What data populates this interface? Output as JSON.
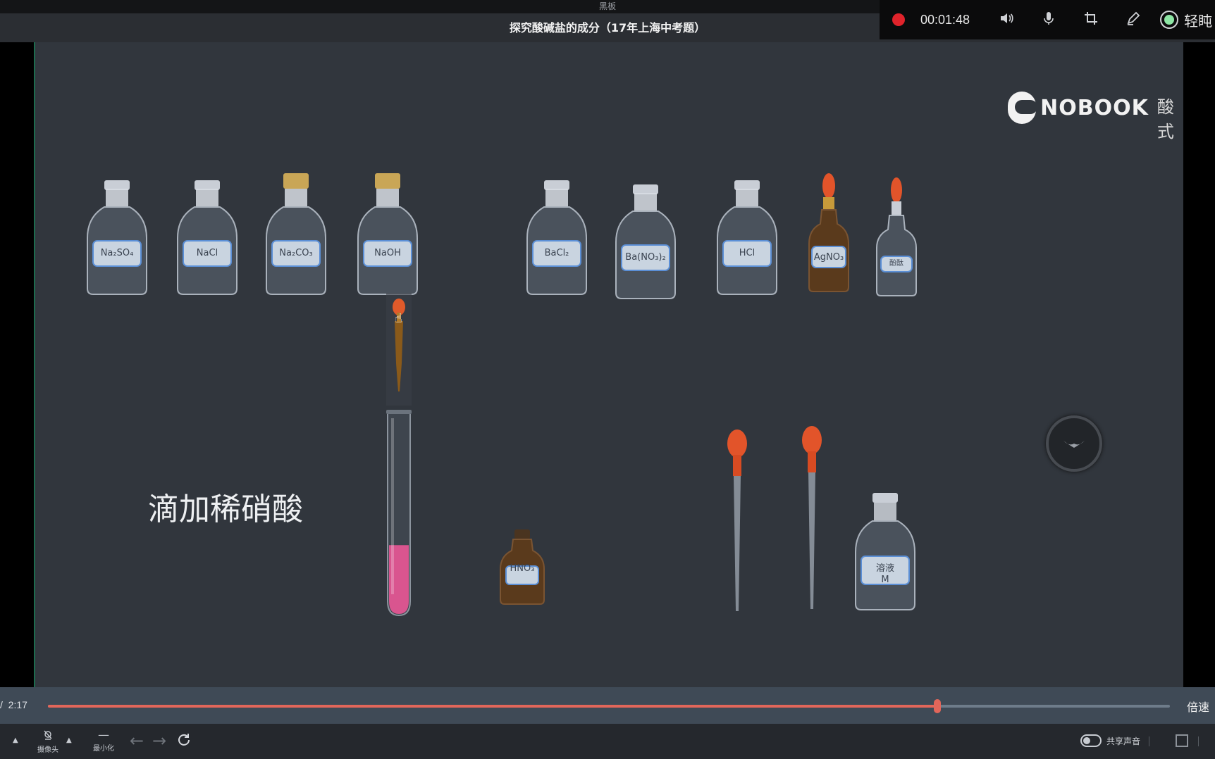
{
  "window": {
    "top_title": "黑板",
    "doc_title": "探究酸碱盐的成分（17年上海中考题）"
  },
  "recorder": {
    "time": "00:01:48",
    "icons": [
      "speaker-icon",
      "microphone-icon",
      "crop-icon",
      "pen-icon"
    ],
    "extra_text": "轻盹"
  },
  "stage": {
    "logo_text": "NOBOOK",
    "logo_sub": "酸式",
    "caption": "滴加稀硝酸",
    "top_bottles": [
      {
        "label": "Na₂SO₄",
        "type": "clear"
      },
      {
        "label": "NaCl",
        "type": "clear"
      },
      {
        "label": "Na₂CO₃",
        "type": "cork"
      },
      {
        "label": "NaOH",
        "type": "cork"
      },
      {
        "label": "BaCl₂",
        "type": "clear"
      },
      {
        "label": "Ba(NO₃)₂",
        "type": "clear"
      },
      {
        "label": "HCl",
        "type": "clear"
      },
      {
        "label": "AgNO₃",
        "type": "dropper-brown"
      },
      {
        "label": "酚酞",
        "type": "dropper-clear"
      }
    ],
    "small_bottle": {
      "label": "HNO₃"
    },
    "solution_bottle": {
      "label_line1": "溶液",
      "label_line2": "M"
    },
    "test_tube_fill": 0.3,
    "float_button_icon": "bird-icon"
  },
  "player": {
    "elapsed": "/",
    "duration": "2:17",
    "progress": 0.793,
    "speed_label": "倍速"
  },
  "toolbar": {
    "camera_label": "摄像头",
    "minimize_label": "最小化",
    "share_audio_label": "共享声音"
  },
  "colors": {
    "accent": "#e2665a",
    "stage_bg": "#31363d",
    "rec_red": "#e0232b"
  }
}
